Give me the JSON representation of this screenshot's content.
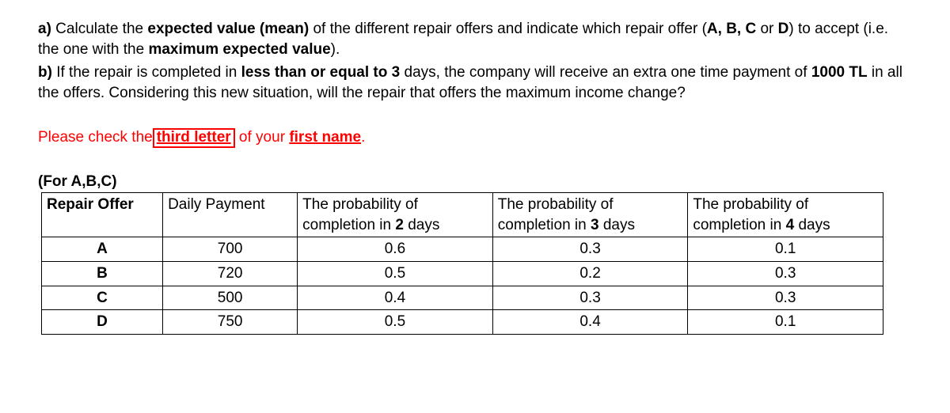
{
  "partA": {
    "label": "a)",
    "t1": " Calculate the ",
    "bold1": "expected value (mean)",
    "t2": " of the different repair offers and indicate which repair offer (",
    "bold2": "A, B, C",
    "t3": " or ",
    "bold3": "D",
    "t4": ") to accept (i.e. the one with the ",
    "bold4": "maximum expected value",
    "t5": ")."
  },
  "partB": {
    "label": "b)",
    "t1": " If the repair is completed in ",
    "bold1": "less than or equal to 3",
    "t2": " days, the company will receive an extra one time payment of ",
    "bold2": "1000 TL",
    "t3": " in all the offers. Considering this new situation, will the repair that offers the maximum income change?"
  },
  "instruction": {
    "pre": "Please check the",
    "boxed": " third letter ",
    "mid": " of your ",
    "underlined": "first name",
    "post": "."
  },
  "tableLabel": "(For A,B,C)",
  "headers": {
    "offer": "Repair Offer",
    "payment": "Daily Payment",
    "p2a": "The probability of",
    "p2b": "completion in ",
    "p2bold": "2",
    "p2c": " days",
    "p3a": "The probability of",
    "p3b": "completion in ",
    "p3bold": "3",
    "p3c": " days",
    "p4a": "The probability of",
    "p4b": "completion in ",
    "p4bold": "4",
    "p4c": " days"
  },
  "rows": [
    {
      "offer": "A",
      "payment": "700",
      "p2": "0.6",
      "p3": "0.3",
      "p4": "0.1"
    },
    {
      "offer": "B",
      "payment": "720",
      "p2": "0.5",
      "p3": "0.2",
      "p4": "0.3"
    },
    {
      "offer": "C",
      "payment": "500",
      "p2": "0.4",
      "p3": "0.3",
      "p4": "0.3"
    },
    {
      "offer": "D",
      "payment": "750",
      "p2": "0.5",
      "p3": "0.4",
      "p4": "0.1"
    }
  ],
  "chart_data": {
    "type": "table",
    "columns": [
      "Repair Offer",
      "Daily Payment",
      "P(2 days)",
      "P(3 days)",
      "P(4 days)"
    ],
    "rows": [
      [
        "A",
        700,
        0.6,
        0.3,
        0.1
      ],
      [
        "B",
        720,
        0.5,
        0.2,
        0.3
      ],
      [
        "C",
        500,
        0.4,
        0.3,
        0.3
      ],
      [
        "D",
        750,
        0.5,
        0.4,
        0.1
      ]
    ]
  }
}
